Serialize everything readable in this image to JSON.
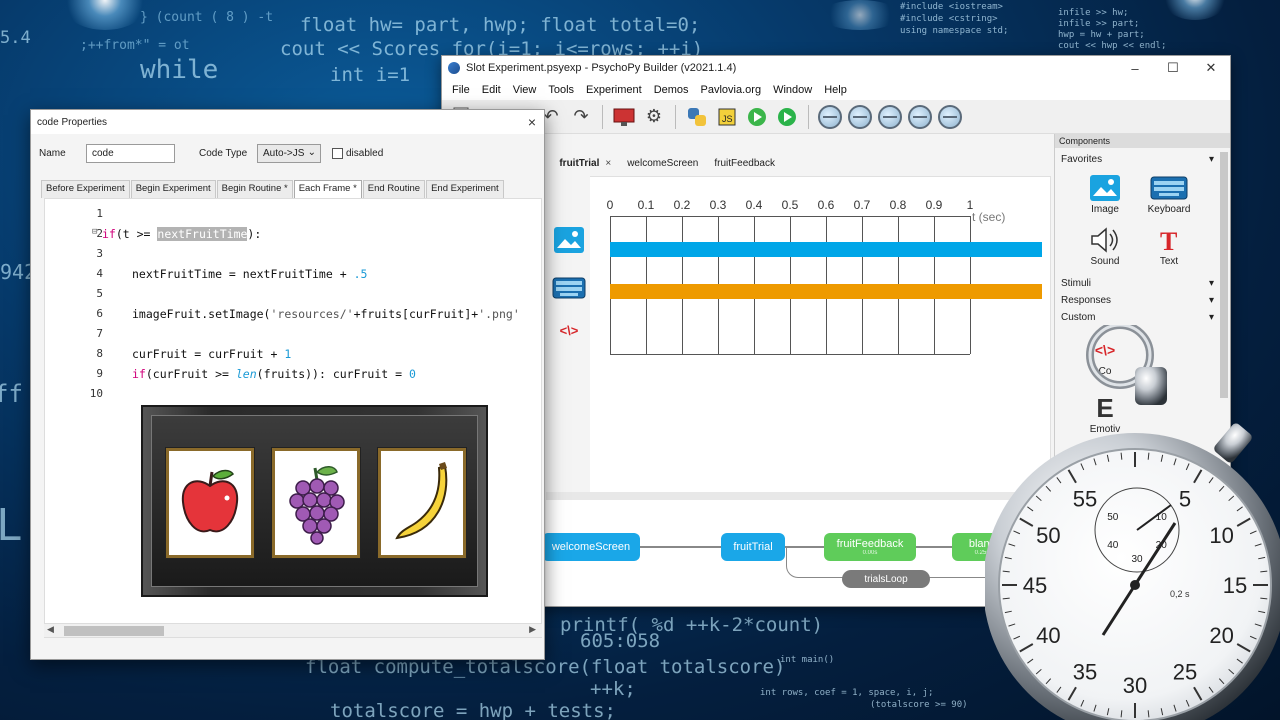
{
  "background": {
    "code_lines": [
      "} (count ( 8 ) -t",
      "float hw= part, hwp; float total=0;",
      "cout << Scores for(i=1; i<=rows; ++i)",
      ";++from*\" = ot",
      "while",
      "int i=1",
      "5.4",
      "printf( %d  ++k-2*count)",
      "float compute_totalscore(float totalscore)",
      "++k;",
      "totalscore = hwp + tests;",
      "605:058",
      "#include <iostream>",
      "#include <cstring>",
      "using namespace std;",
      "infile >> hw;",
      "infile >> part;",
      "hwp = hw + part;",
      "cout << hwp << endl;",
      "int main()",
      "int rows, coef = 1, space, i, j;",
      "(totalscore >= 90)"
    ]
  },
  "builder": {
    "title": "Slot Experiment.psyexp - PsychoPy Builder (v2021.1.4)",
    "menu": [
      "File",
      "Edit",
      "View",
      "Tools",
      "Experiment",
      "Demos",
      "Pavlovia.org",
      "Window",
      "Help"
    ],
    "tabs": [
      {
        "label": ")",
        "active": false
      },
      {
        "label": "fruitTrial",
        "active": true,
        "close": "×"
      },
      {
        "label": "welcomeScreen",
        "active": false
      },
      {
        "label": "fruitFeedback",
        "active": false
      }
    ],
    "timeline": {
      "ticks": [
        "0",
        "0.1",
        "0.2",
        "0.3",
        "0.4",
        "0.5",
        "0.6",
        "0.7",
        "0.8",
        "0.9",
        "1"
      ],
      "unit_label": "t (sec)",
      "bars": [
        {
          "color": "#00a6e8",
          "start": 0,
          "end": 1.2
        },
        {
          "color": "#ee9a00",
          "start": 0,
          "end": 1.2
        }
      ]
    },
    "flow": {
      "routines": [
        {
          "label": "welcomeScreen",
          "color": "#1aa7e8",
          "sub": ""
        },
        {
          "label": "fruitTrial",
          "color": "#1aa7e8",
          "sub": ""
        },
        {
          "label": "fruitFeedback",
          "color": "#5fcc5a",
          "sub": "0.00s"
        },
        {
          "label": "blank",
          "color": "#5fcc5a",
          "sub": "0.25s"
        }
      ],
      "loop_label": "trialsLoop"
    },
    "components_panel": {
      "header": "Components",
      "favorites_label": "Favorites",
      "items": [
        {
          "label": "Image",
          "icon": "image-icon"
        },
        {
          "label": "Keyboard",
          "icon": "keyboard-icon"
        },
        {
          "label": "Sound",
          "icon": "sound-icon"
        },
        {
          "label": "Text",
          "icon": "text-icon"
        }
      ],
      "categories": [
        "Stimuli",
        "Responses",
        "Custom"
      ],
      "partial_items": [
        "Co",
        "Emotiv"
      ]
    }
  },
  "dialog": {
    "title": "code Properties",
    "close": "×",
    "name_label": "Name",
    "name_value": "code",
    "code_type_label": "Code Type",
    "code_type_value": "Auto->JS",
    "disabled_label": "disabled",
    "tabs": [
      "Before Experiment",
      "Begin Experiment",
      "Begin Routine *",
      "Each Frame *",
      "End Routine",
      "End Experiment"
    ],
    "active_tab": 3,
    "line_numbers": [
      "1",
      "2",
      "3",
      "4",
      "5",
      "6",
      "7",
      "8",
      "9",
      "10"
    ],
    "code": {
      "l2_a": "if",
      "l2_b": "(t >= ",
      "l2_c": "nextFruitTime",
      "l2_d": "):",
      "l4": "nextFruitTime = nextFruitTime + ",
      "l4_num": ".5",
      "l6_a": "imageFruit.setImage(",
      "l6_b": "'resources/'",
      "l6_c": "+fruits[curFruit]+",
      "l6_d": "'.png'",
      "l8": "curFruit = curFruit + ",
      "l8_num": "1",
      "l9_a": "if",
      "l9_b": "(curFruit >= ",
      "l9_c": "len",
      "l9_d": "(fruits)): curFruit = ",
      "l9_num": "0"
    }
  },
  "slot_machine": {
    "reels": [
      "apple-icon",
      "grapes-icon",
      "banana-icon"
    ]
  },
  "stopwatch": {
    "numbers": [
      "55",
      "5",
      "10",
      "15",
      "20",
      "25",
      "30",
      "35",
      "40",
      "45",
      "50"
    ],
    "inner_numbers": [
      "10",
      "20",
      "30",
      "40",
      "50"
    ],
    "unit": "0,2 s"
  }
}
